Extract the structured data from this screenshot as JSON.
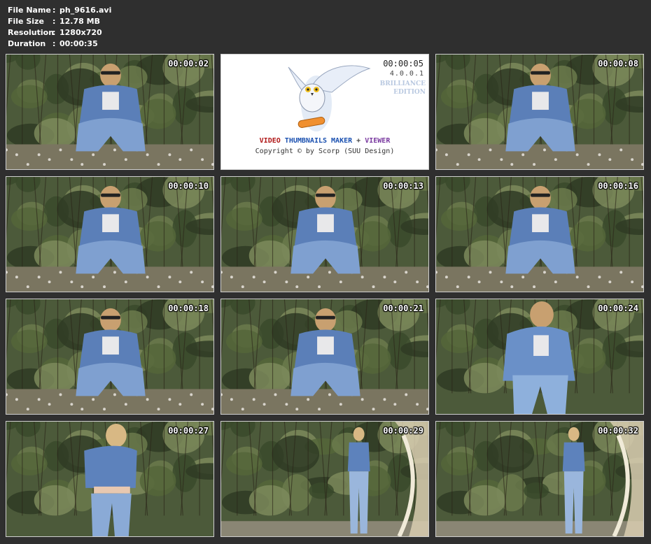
{
  "file_info": [
    {
      "key": "File Name",
      "value": "ph_9616.avi"
    },
    {
      "key": "File Size",
      "value": "12.78 MB"
    },
    {
      "key": "Resolution",
      "value": "1280x720"
    },
    {
      "key": "Duration",
      "value": "00:00:35"
    }
  ],
  "colon": ":",
  "splash": {
    "timestamp": "00:00:05",
    "version": "4.0.0.1",
    "edition_line1": "BRILLIANCE",
    "edition_line2": "EDITION",
    "product_video": "VIDEO",
    "product_thumbnails": "THUMBNAILS MAKER",
    "product_plus": "+",
    "product_viewer": "VIEWER",
    "copyright": "Copyright © by Scorp (SUU Design)",
    "colors": {
      "video": "#b01818",
      "thumbnails": "#1a50b0",
      "plus": "#444444",
      "viewer": "#7a3aa0"
    }
  },
  "thumbnails": [
    {
      "timestamp": "00:00:02",
      "scene": "crouch"
    },
    {
      "timestamp": "00:00:08",
      "scene": "crouch"
    },
    {
      "timestamp": "00:00:10",
      "scene": "crouch"
    },
    {
      "timestamp": "00:00:13",
      "scene": "crouch"
    },
    {
      "timestamp": "00:00:16",
      "scene": "crouch"
    },
    {
      "timestamp": "00:00:18",
      "scene": "crouch"
    },
    {
      "timestamp": "00:00:21",
      "scene": "crouch"
    },
    {
      "timestamp": "00:00:24",
      "scene": "close"
    },
    {
      "timestamp": "00:00:27",
      "scene": "stand"
    },
    {
      "timestamp": "00:00:29",
      "scene": "far"
    },
    {
      "timestamp": "00:00:32",
      "scene": "far"
    }
  ]
}
